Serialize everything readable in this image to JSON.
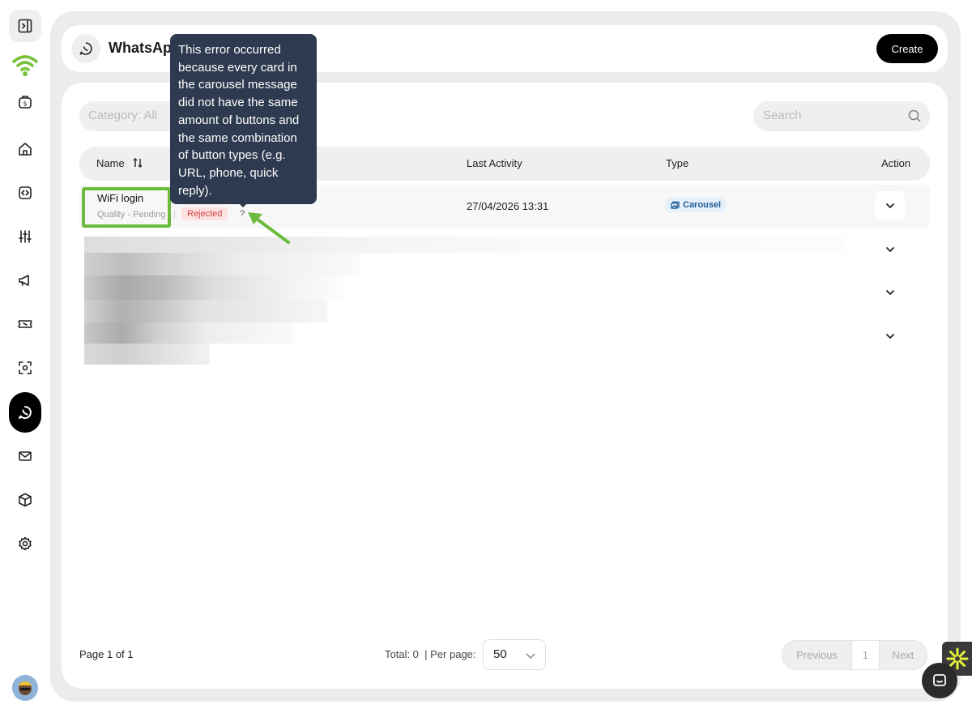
{
  "header": {
    "title": "WhatsApp",
    "create_label": "Create"
  },
  "filters": {
    "category": "Category: All",
    "search_placeholder": "Search"
  },
  "table": {
    "columns": [
      "Name",
      "Last Activity",
      "Type",
      "Action"
    ],
    "rows": [
      {
        "name": "WiFi login",
        "quality": "Quality - Pending",
        "separator": "|",
        "status": "Rejected",
        "help": "?",
        "last_activity": "27/04/2026 13:31",
        "type": "Carousel"
      }
    ]
  },
  "tooltip": {
    "text": "This error occurred because every card in the carousel message did not have the same amount of buttons and the same combination of button types (e.g. URL, phone, quick reply)."
  },
  "footer": {
    "page_info": "Page 1 of 1",
    "total": "Total: 0",
    "per_page_label": "| Per page:",
    "per_page_value": "50",
    "previous": "Previous",
    "current_page": "1",
    "next": "Next"
  },
  "colors": {
    "accent_green": "#6dbb3e",
    "tooltip_bg": "#2e3a4f",
    "rejected_bg": "#fde2e2",
    "carousel_bg": "#e6f0fb"
  }
}
